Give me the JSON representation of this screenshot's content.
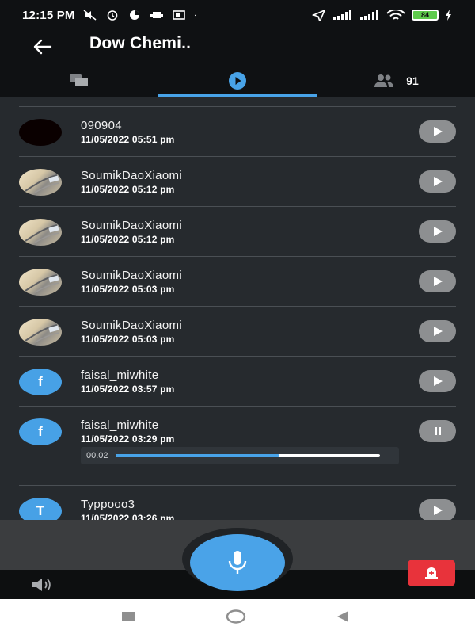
{
  "status": {
    "time": "12:15 PM",
    "battery": "84"
  },
  "header": {
    "title": "Dow Chemi..",
    "tabs": [
      {
        "icon": "chat-icon",
        "label": ""
      },
      {
        "icon": "play-circle-icon",
        "label": ""
      },
      {
        "icon": "people-icon",
        "count": "91"
      }
    ]
  },
  "messages": [
    {
      "name": "090904",
      "time": "11/05/2022 05:51 pm",
      "avatar": "blank",
      "state": "play"
    },
    {
      "name": "SoumikDaoXiaomi",
      "time": "11/05/2022 05:12 pm",
      "avatar": "photo",
      "state": "play"
    },
    {
      "name": "SoumikDaoXiaomi",
      "time": "11/05/2022 05:12 pm",
      "avatar": "photo",
      "state": "play"
    },
    {
      "name": "SoumikDaoXiaomi",
      "time": "11/05/2022 05:03 pm",
      "avatar": "photo",
      "state": "play"
    },
    {
      "name": "SoumikDaoXiaomi",
      "time": "11/05/2022 05:03 pm",
      "avatar": "photo",
      "state": "play"
    },
    {
      "name": "faisal_miwhite",
      "time": "11/05/2022 03:57 pm",
      "avatar": "letter",
      "letter": "f",
      "state": "play"
    },
    {
      "name": "faisal_miwhite",
      "time": "11/05/2022 03:29 pm",
      "avatar": "letter",
      "letter": "f",
      "state": "pause",
      "progress_time": "00.02",
      "progress": 0.62
    },
    {
      "name": "Typpooo3",
      "time": "11/05/2022 03:26 pm",
      "avatar": "letter",
      "letter": "T",
      "state": "play"
    }
  ],
  "colors": {
    "accent": "#48a3e8",
    "alert": "#e8333b",
    "background": "#262a2e"
  }
}
